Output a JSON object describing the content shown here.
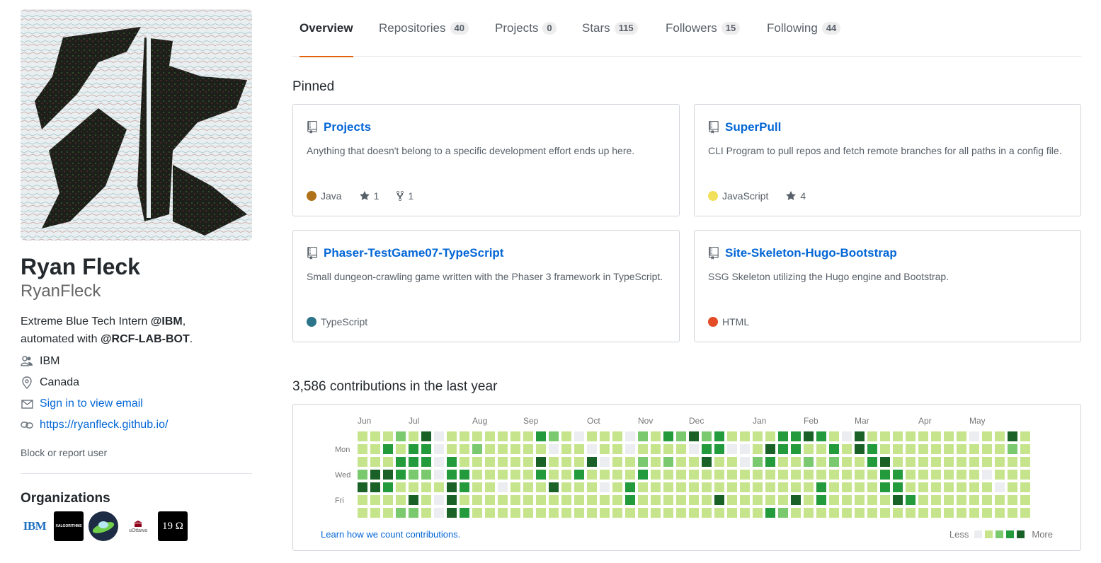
{
  "profile": {
    "full_name": "Ryan Fleck",
    "username": "RyanFleck",
    "bio_prefix": "Extreme Blue Tech Intern ",
    "bio_mention1": "@IBM",
    "bio_mid": ",",
    "bio_line2_prefix": "automated with ",
    "bio_mention2": "@RCF-LAB-BOT",
    "bio_end": ".",
    "company": "IBM",
    "location": "Canada",
    "email_link": "Sign in to view email",
    "website": "https://ryanfleck.github.io/",
    "block_link": "Block or report user"
  },
  "organizations": {
    "title": "Organizations",
    "items": [
      {
        "name": "ibm-org-logo",
        "label": "IBM"
      },
      {
        "name": "xalgorithms-org-logo",
        "label": "XALGORITHMS"
      },
      {
        "name": "spaceship-org-logo",
        "label": ""
      },
      {
        "name": "uottawa-org-logo",
        "label": "uOttawa"
      },
      {
        "name": "1990-org-logo",
        "label": "19 Ω"
      }
    ]
  },
  "tabs": [
    {
      "label": "Overview",
      "count": null,
      "selected": true
    },
    {
      "label": "Repositories",
      "count": "40"
    },
    {
      "label": "Projects",
      "count": "0"
    },
    {
      "label": "Stars",
      "count": "115"
    },
    {
      "label": "Followers",
      "count": "15"
    },
    {
      "label": "Following",
      "count": "44"
    }
  ],
  "pinned": {
    "title": "Pinned",
    "repos": [
      {
        "name": "Projects",
        "desc": "Anything that doesn't belong to a specific development effort ends up here.",
        "lang": "Java",
        "lang_color": "#b07219",
        "stars": "1",
        "forks": "1"
      },
      {
        "name": "SuperPull",
        "desc": "CLI Program to pull repos and fetch remote branches for all paths in a config file.",
        "lang": "JavaScript",
        "lang_color": "#f1e05a",
        "stars": "4",
        "forks": null
      },
      {
        "name": "Phaser-TestGame07-TypeScript",
        "desc": "Small dungeon-crawling game written with the Phaser 3 framework in TypeScript.",
        "lang": "TypeScript",
        "lang_color": "#2b7489",
        "stars": null,
        "forks": null
      },
      {
        "name": "Site-Skeleton-Hugo-Bootstrap",
        "desc": "SSG Skeleton utilizing the Hugo engine and Bootstrap.",
        "lang": "HTML",
        "lang_color": "#e34c26",
        "stars": null,
        "forks": null
      }
    ]
  },
  "contributions": {
    "title": "3,586 contributions in the last year",
    "months": [
      "Jun",
      "Jul",
      "Aug",
      "Sep",
      "Oct",
      "Nov",
      "Dec",
      "Jan",
      "Feb",
      "Mar",
      "Apr",
      "May"
    ],
    "weekdays": [
      "Mon",
      "Wed",
      "Fri"
    ],
    "learn_link": "Learn how we count contributions.",
    "legend_less": "Less",
    "legend_more": "More",
    "colors": [
      "#ebedf0",
      "#c6e48b",
      "#7bc96f",
      "#239a3b",
      "#196127"
    ],
    "weeks": [
      [
        1,
        1,
        1,
        2,
        4,
        1,
        1
      ],
      [
        1,
        1,
        1,
        4,
        4,
        1,
        1
      ],
      [
        1,
        3,
        1,
        4,
        3,
        1,
        1
      ],
      [
        2,
        1,
        3,
        3,
        1,
        1,
        2
      ],
      [
        1,
        3,
        3,
        2,
        1,
        4,
        2
      ],
      [
        4,
        3,
        3,
        2,
        1,
        1,
        1
      ],
      [
        0,
        0,
        0,
        0,
        1,
        0,
        0
      ],
      [
        1,
        1,
        3,
        3,
        4,
        4,
        4
      ],
      [
        1,
        1,
        1,
        3,
        3,
        1,
        3
      ],
      [
        1,
        2,
        1,
        1,
        1,
        1,
        1
      ],
      [
        1,
        1,
        1,
        1,
        1,
        1,
        1
      ],
      [
        1,
        1,
        1,
        1,
        0,
        1,
        1
      ],
      [
        1,
        1,
        1,
        1,
        1,
        1,
        1
      ],
      [
        1,
        1,
        1,
        1,
        1,
        1,
        1
      ],
      [
        3,
        1,
        4,
        3,
        1,
        1,
        1
      ],
      [
        2,
        0,
        1,
        1,
        4,
        1,
        1
      ],
      [
        1,
        1,
        1,
        1,
        1,
        1,
        1
      ],
      [
        0,
        1,
        1,
        3,
        1,
        1,
        1
      ],
      [
        1,
        0,
        4,
        1,
        1,
        1,
        1
      ],
      [
        1,
        1,
        0,
        1,
        0,
        1,
        1
      ],
      [
        1,
        1,
        1,
        1,
        1,
        1,
        1
      ],
      [
        0,
        0,
        1,
        1,
        3,
        3,
        1
      ],
      [
        2,
        1,
        2,
        3,
        1,
        1,
        1
      ],
      [
        1,
        1,
        1,
        1,
        1,
        1,
        1
      ],
      [
        3,
        1,
        2,
        1,
        1,
        1,
        1
      ],
      [
        2,
        1,
        1,
        1,
        1,
        1,
        1
      ],
      [
        4,
        0,
        1,
        1,
        1,
        1,
        1
      ],
      [
        2,
        3,
        4,
        1,
        1,
        1,
        1
      ],
      [
        3,
        3,
        1,
        1,
        1,
        4,
        1
      ],
      [
        1,
        0,
        1,
        1,
        1,
        1,
        1
      ],
      [
        1,
        0,
        0,
        1,
        1,
        1,
        1
      ],
      [
        1,
        1,
        2,
        1,
        1,
        1,
        1
      ],
      [
        1,
        4,
        3,
        1,
        1,
        1,
        3
      ],
      [
        3,
        3,
        1,
        1,
        1,
        1,
        2
      ],
      [
        3,
        3,
        1,
        1,
        1,
        4,
        1
      ],
      [
        4,
        1,
        2,
        1,
        1,
        1,
        1
      ],
      [
        3,
        1,
        1,
        1,
        3,
        3,
        1
      ],
      [
        1,
        3,
        2,
        1,
        1,
        1,
        1
      ],
      [
        0,
        1,
        1,
        1,
        1,
        1,
        1
      ],
      [
        4,
        4,
        1,
        1,
        1,
        1,
        1
      ],
      [
        1,
        3,
        3,
        1,
        1,
        1,
        1
      ],
      [
        1,
        1,
        4,
        3,
        3,
        1,
        1
      ],
      [
        1,
        1,
        1,
        3,
        3,
        4,
        1
      ],
      [
        1,
        1,
        1,
        1,
        1,
        3,
        1
      ],
      [
        1,
        1,
        1,
        1,
        1,
        1,
        1
      ],
      [
        1,
        1,
        1,
        1,
        1,
        1,
        1
      ],
      [
        1,
        1,
        1,
        1,
        1,
        1,
        1
      ],
      [
        1,
        1,
        1,
        1,
        1,
        1,
        1
      ],
      [
        0,
        1,
        1,
        1,
        1,
        1,
        1
      ],
      [
        1,
        1,
        1,
        0,
        1,
        1,
        1
      ],
      [
        1,
        1,
        1,
        1,
        0,
        1,
        1
      ],
      [
        4,
        2,
        1,
        1,
        1,
        1,
        1
      ],
      [
        1,
        1,
        1,
        1,
        1,
        1,
        1
      ]
    ]
  }
}
